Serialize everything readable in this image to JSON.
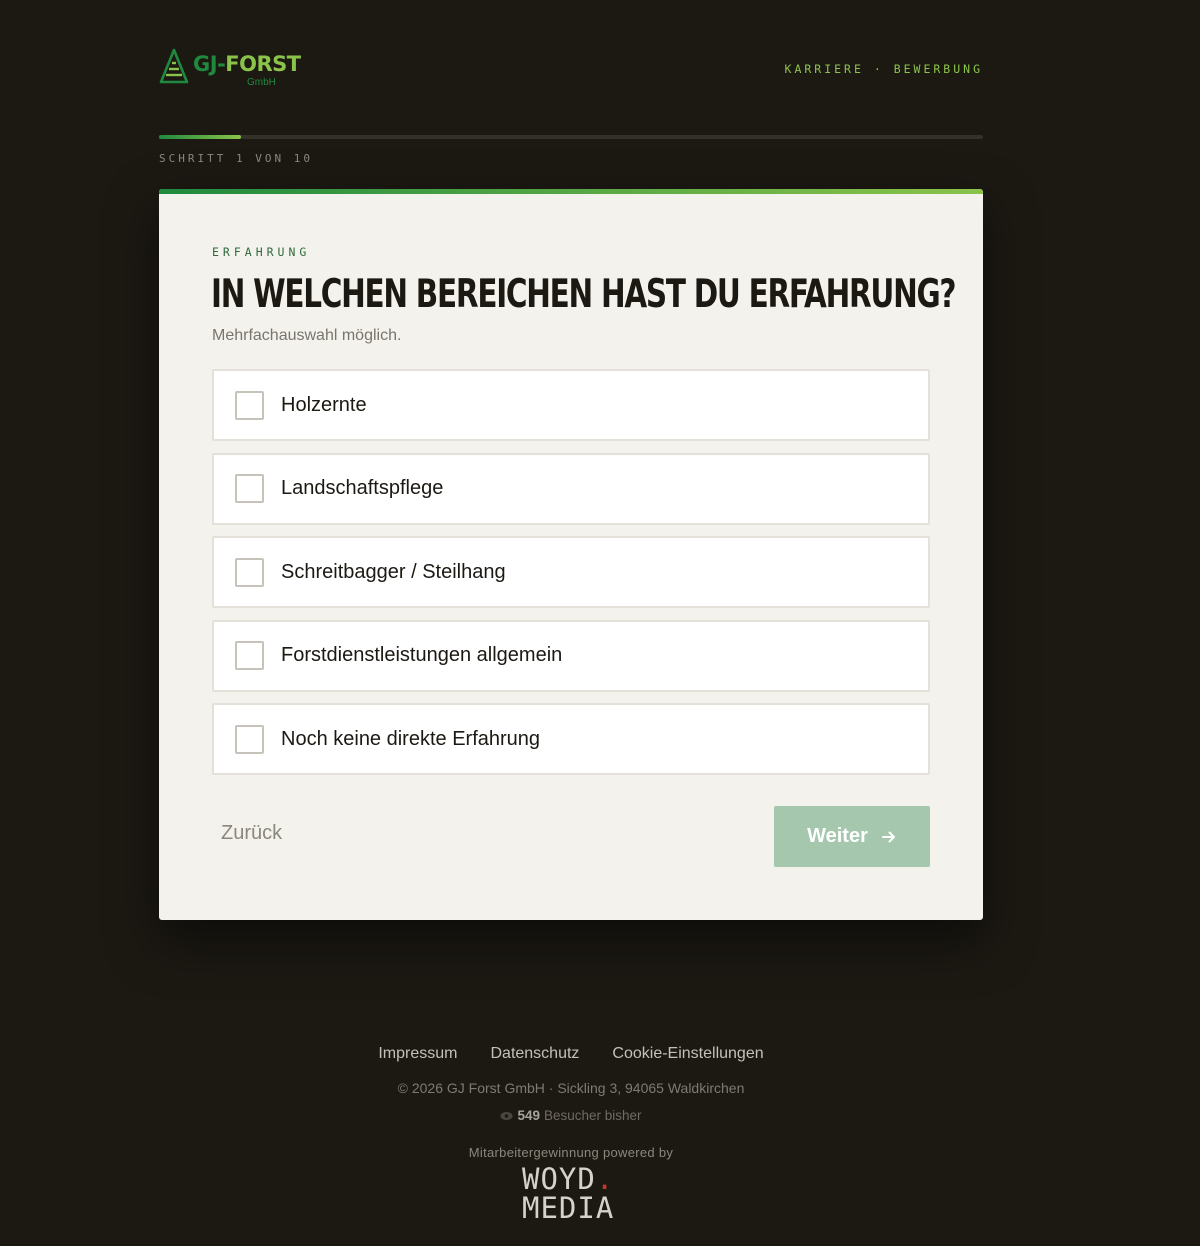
{
  "brand": {
    "name_part1": "GJ",
    "name_separator": "-",
    "name_part2": "FORST",
    "legal": "GmbH",
    "colors": {
      "green": "#1f8a3e",
      "lime": "#8bc34a",
      "background": "#1c1913",
      "card": "#f4f2ed"
    }
  },
  "nav": {
    "item1": "KARRIERE",
    "separator": " · ",
    "item2": "BEWERBUNG"
  },
  "progress": {
    "current_step": 1,
    "total_steps": 10,
    "fraction": 0.1,
    "label": "SCHRITT 1 VON 10"
  },
  "question": {
    "eyebrow": "ERFAHRUNG",
    "title": "IN WELCHEN BEREICHEN HAST DU ERFAHRUNG?",
    "hint": "Mehrfachauswahl möglich."
  },
  "options": [
    {
      "label": "Holzernte",
      "checked": false
    },
    {
      "label": "Landschaftspflege",
      "checked": false
    },
    {
      "label": "Schreitbagger / Steilhang",
      "checked": false
    },
    {
      "label": "Forstdienstleistungen allgemein",
      "checked": false
    },
    {
      "label": "Noch keine direkte Erfahrung",
      "checked": false
    }
  ],
  "actions": {
    "back_label": "Zurück",
    "next_label": "Weiter",
    "next_icon": "arrow-right-icon",
    "next_disabled_color": "#a5c7ae"
  },
  "footer": {
    "links": [
      "Impressum",
      "Datenschutz",
      "Cookie-Einstellungen"
    ],
    "copyright": "© 2026 GJ Forst GmbH · Sickling 3, 94065 Waldkirchen",
    "visitor_count": "549",
    "visitor_text": "Besucher bisher",
    "visitor_icon": "eye-icon",
    "powered_by": "Mitarbeitergewinnung powered by",
    "agency_line1": "WOYD",
    "agency_dot": ".",
    "agency_line2": "MEDIA"
  }
}
